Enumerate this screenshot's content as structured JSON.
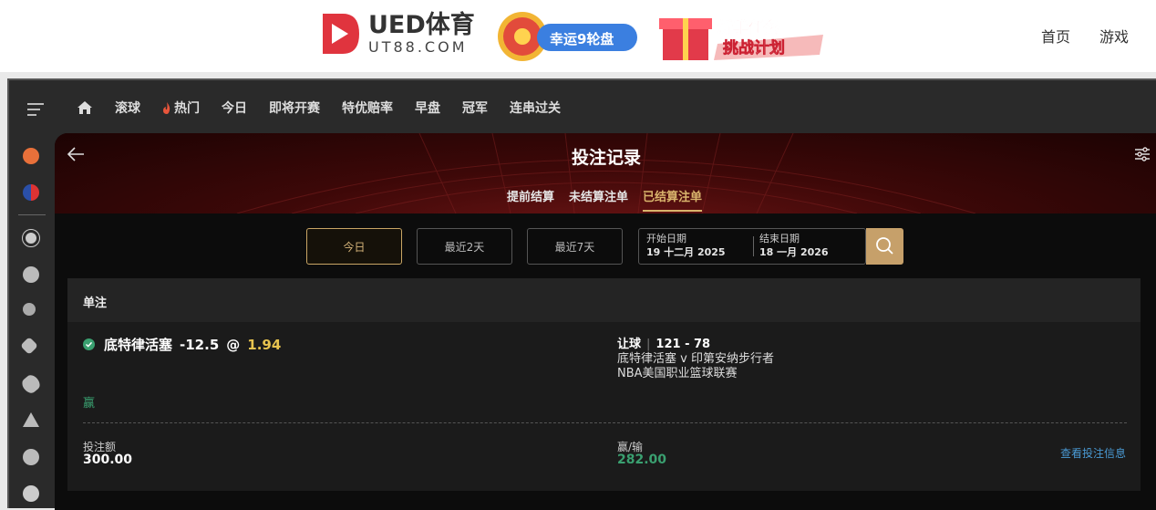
{
  "header": {
    "logo_title": "UED体育",
    "logo_sub": "UT88.COM",
    "promo1_text": "幸运9轮盘",
    "promo2_line1": "新手任务",
    "promo2_line2": "挑战计划",
    "nav": [
      "首页",
      "游戏"
    ]
  },
  "topnav": {
    "items": [
      "滚球",
      "热门",
      "今日",
      "即将开赛",
      "特优赔率",
      "早盘",
      "冠军",
      "连串过关"
    ]
  },
  "sidebar": {
    "icons": [
      "soccer-ball-icon",
      "nba-icon",
      "soccer-icon",
      "basketball-icon",
      "tennis-icon",
      "badminton-icon",
      "rugby-icon",
      "billiards-icon",
      "table-tennis-icon",
      "volleyball-icon"
    ]
  },
  "page": {
    "title": "投注记录",
    "tabs": [
      "提前结算",
      "未结算注单",
      "已结算注单"
    ],
    "active_tab": 2
  },
  "filters": {
    "buttons": [
      "今日",
      "最近2天",
      "最近7天"
    ],
    "start_label": "开始日期",
    "start_value": "19 十二月 2025",
    "end_label": "结束日期",
    "end_value": "18 一月 2026"
  },
  "bet": {
    "section": "单注",
    "team": "底特律活塞",
    "handicap": "-12.5",
    "at": "@",
    "odds": "1.94",
    "result": "赢",
    "market": "让球",
    "score": "121 - 78",
    "match": "底特律活塞 v 印第安纳步行者",
    "league": "NBA美国职业篮球联赛",
    "stake_label": "投注额",
    "stake_value": "300.00",
    "winloss_label": "赢/输",
    "winloss_value": "282.00",
    "detail_link": "查看投注信息"
  },
  "colors": {
    "accent": "#c6a06a",
    "win": "#3aa070",
    "odds": "#e7c34f",
    "link": "#4a9ad4"
  }
}
